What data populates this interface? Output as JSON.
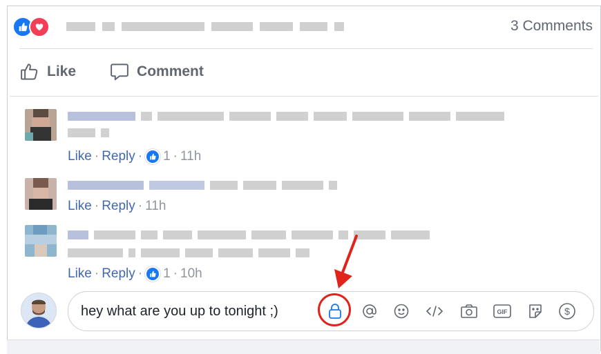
{
  "post": {
    "comments_count": "3 Comments",
    "reaction_icons": [
      "like-reaction-icon",
      "love-reaction-icon"
    ]
  },
  "actions": {
    "like_label": "Like",
    "comment_label": "Comment"
  },
  "comments": [
    {
      "like_label": "Like",
      "reply_label": "Reply",
      "reaction_count": "1",
      "time": "11h",
      "has_reaction": true
    },
    {
      "like_label": "Like",
      "reply_label": "Reply",
      "time": "11h",
      "has_reaction": false
    },
    {
      "like_label": "Like",
      "reply_label": "Reply",
      "reaction_count": "1",
      "time": "10h",
      "has_reaction": true
    }
  ],
  "composer": {
    "value": "hey what are you up to tonight ;)",
    "tools": [
      "lock-icon",
      "mention-icon",
      "emoji-icon",
      "code-icon",
      "camera-icon",
      "gif-icon",
      "sticker-icon",
      "dollar-icon"
    ]
  },
  "colors": {
    "link": "#4267b2",
    "meta": "#90949c",
    "like_blue": "#1877f2",
    "love_red": "#f33e58",
    "highlight": "#e0241b"
  }
}
